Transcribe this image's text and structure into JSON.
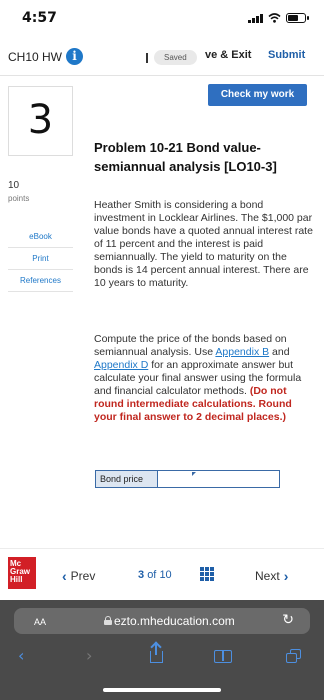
{
  "status_bar": {
    "time": "4:57"
  },
  "header": {
    "title": "CH10 HW",
    "saved_label": "Saved",
    "save_exit_label": "ve & Exit",
    "submit_label": "Submit"
  },
  "check_work_label": "Check my work",
  "question": {
    "number": "3",
    "points_value": "10",
    "points_label": "points"
  },
  "resources": [
    "eBook",
    "Print",
    "References"
  ],
  "problem": {
    "title": "Problem 10-21 Bond value-semiannual analysis [LO10-3]",
    "paragraph1": "Heather Smith is considering a bond investment in Locklear Airlines. The $1,000 par value bonds have a quoted annual interest rate of 11 percent and the interest is paid semiannually. The yield to maturity on the bonds is 14 percent annual interest. There are 10 years to maturity.",
    "p2_before": "Compute the price of the bonds based on semiannual analysis. Use ",
    "p2_link1": "Appendix B",
    "p2_and": " and ",
    "p2_link2": "Appendix D",
    "p2_middle": " for an approximate answer but calculate your final answer using the formula and financial calculator methods. ",
    "p2_bold": "(Do not round intermediate calculations. Round your final answer to 2 decimal places.)"
  },
  "answer": {
    "label": "Bond price",
    "value": ""
  },
  "footer": {
    "logo_lines": [
      "Mc",
      "Graw",
      "Hill"
    ],
    "prev_label": "Prev",
    "page_current": "3",
    "page_of": "of",
    "page_total": "10",
    "next_label": "Next"
  },
  "browser": {
    "aa_label": "AA",
    "url": "ezto.mheducation.com"
  },
  "colors": {
    "accent": "#2f6fc0",
    "link": "#1f78c8",
    "warning": "#c0271f",
    "brand_red": "#d21f26"
  }
}
